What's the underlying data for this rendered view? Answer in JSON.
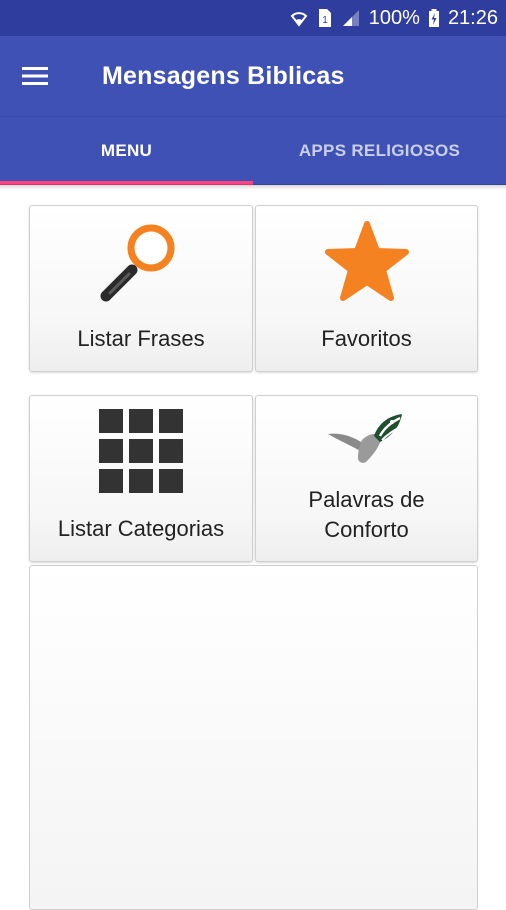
{
  "status_bar": {
    "battery": "100%",
    "time": "21:26",
    "icons": [
      "wifi-icon",
      "sim-icon",
      "signal-icon",
      "battery-charging-icon"
    ]
  },
  "app_bar": {
    "title": "Mensagens Biblicas",
    "menu_icon": "hamburger-menu-icon"
  },
  "tabs": [
    {
      "label": "MENU",
      "active": true
    },
    {
      "label": "APPS RELIGIOSOS",
      "active": false
    }
  ],
  "colors": {
    "primary": "#3f51b5",
    "primary_dark": "#2f3d9e",
    "accent": "#ff4081",
    "icon_orange": "#f58220"
  },
  "menu": {
    "items": [
      {
        "label": "Listar Frases",
        "icon": "magnifier-icon"
      },
      {
        "label": "Favoritos",
        "icon": "star-icon"
      },
      {
        "label": "Listar Categorias",
        "icon": "grid-icon"
      },
      {
        "label_line1": "Palavras de",
        "label_line2": "Conforto",
        "icon": "dove-icon"
      }
    ]
  }
}
